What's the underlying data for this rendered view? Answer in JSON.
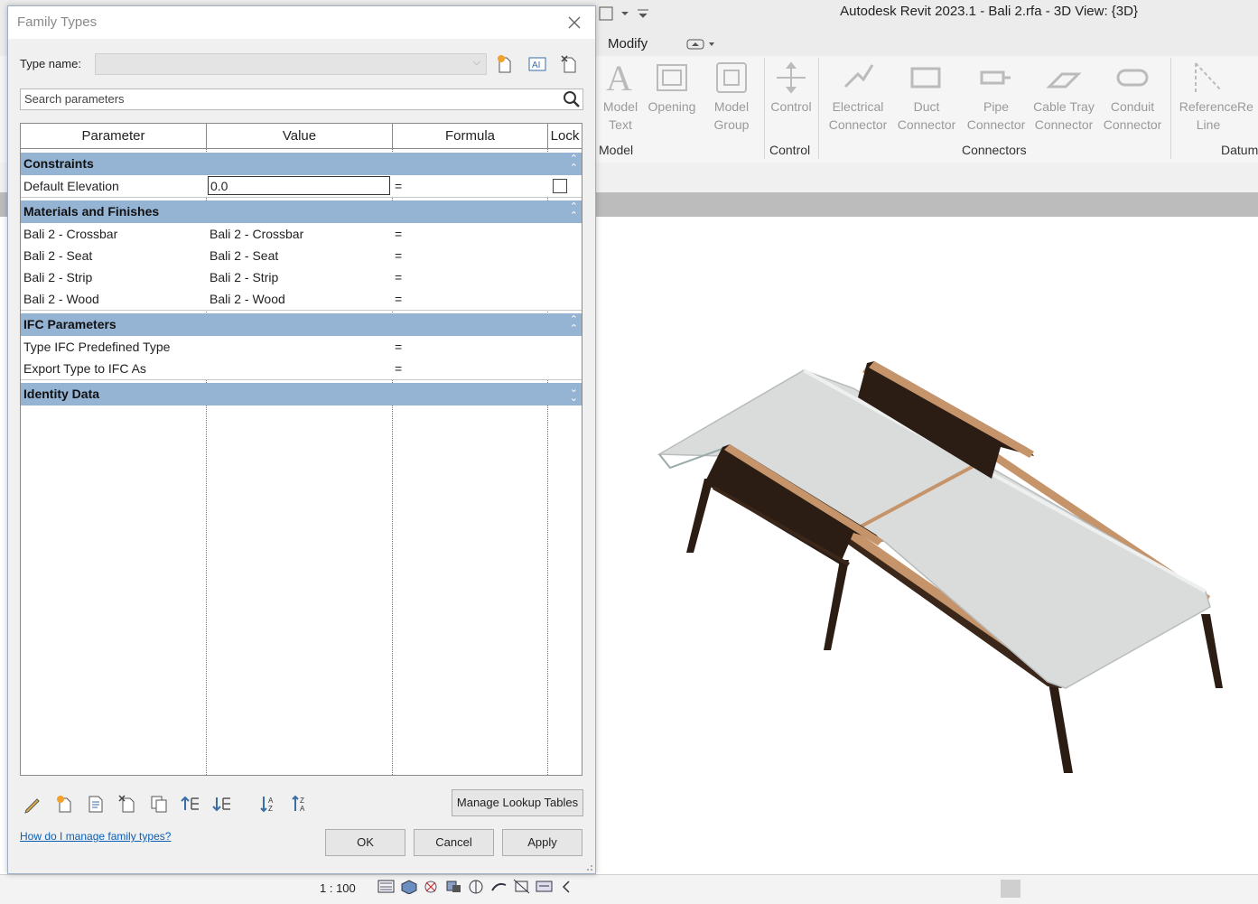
{
  "app": {
    "title": "Autodesk Revit 2023.1 - Bali 2.rfa - 3D View: {3D}",
    "tab_modify": "Modify"
  },
  "ribbon": {
    "buttons": [
      {
        "line1": "Model",
        "line2": "Text",
        "icon": "model-text-icon"
      },
      {
        "line1": "Opening",
        "line2": "",
        "icon": "opening-icon"
      },
      {
        "line1": "Model",
        "line2": "Group",
        "icon": "model-group-icon"
      },
      {
        "line1": "Control",
        "line2": "",
        "icon": "control-icon"
      },
      {
        "line1": "Electrical",
        "line2": "Connector",
        "icon": "electrical-connector-icon"
      },
      {
        "line1": "Duct",
        "line2": "Connector",
        "icon": "duct-connector-icon"
      },
      {
        "line1": "Pipe",
        "line2": "Connector",
        "icon": "pipe-connector-icon"
      },
      {
        "line1": "Cable Tray",
        "line2": "Connector",
        "icon": "cable-tray-connector-icon"
      },
      {
        "line1": "Conduit",
        "line2": "Connector",
        "icon": "conduit-connector-icon"
      },
      {
        "line1": "Reference",
        "line2": "Line",
        "icon": "reference-line-icon"
      },
      {
        "line1": "Re",
        "line2": "",
        "icon": ""
      }
    ],
    "panels": [
      "Model",
      "Control",
      "Connectors",
      "Datum"
    ]
  },
  "status": {
    "scale": "1 : 100"
  },
  "dialog": {
    "title": "Family Types",
    "type_name_label": "Type name:",
    "type_name_value": "",
    "search_placeholder": "Search parameters",
    "columns": [
      "Parameter",
      "Value",
      "Formula",
      "Lock"
    ],
    "groups": [
      {
        "label": "Constraints",
        "collapse": "up",
        "rows": [
          {
            "parameter": "Default Elevation",
            "value": "0.0",
            "formula": "=",
            "lock": false
          }
        ]
      },
      {
        "label": "Materials and Finishes",
        "collapse": "up",
        "rows": [
          {
            "parameter": "Bali 2 - Crossbar",
            "value": "Bali 2 - Crossbar",
            "formula": "="
          },
          {
            "parameter": "Bali 2 - Seat",
            "value": "Bali 2 - Seat",
            "formula": "="
          },
          {
            "parameter": "Bali 2 - Strip",
            "value": "Bali 2 - Strip",
            "formula": "="
          },
          {
            "parameter": "Bali 2 - Wood",
            "value": "Bali 2 - Wood",
            "formula": "="
          }
        ]
      },
      {
        "label": "IFC Parameters",
        "collapse": "up",
        "rows": [
          {
            "parameter": "Type IFC Predefined Type",
            "value": "",
            "formula": "="
          },
          {
            "parameter": "Export Type to IFC As",
            "value": "",
            "formula": "="
          }
        ]
      },
      {
        "label": "Identity Data",
        "collapse": "down",
        "rows": []
      }
    ],
    "manage_lookup_label": "Manage Lookup Tables",
    "help_link": "How do I manage family types?",
    "ok_label": "OK",
    "cancel_label": "Cancel",
    "apply_label": "Apply",
    "header_color": "#95b3d3"
  }
}
